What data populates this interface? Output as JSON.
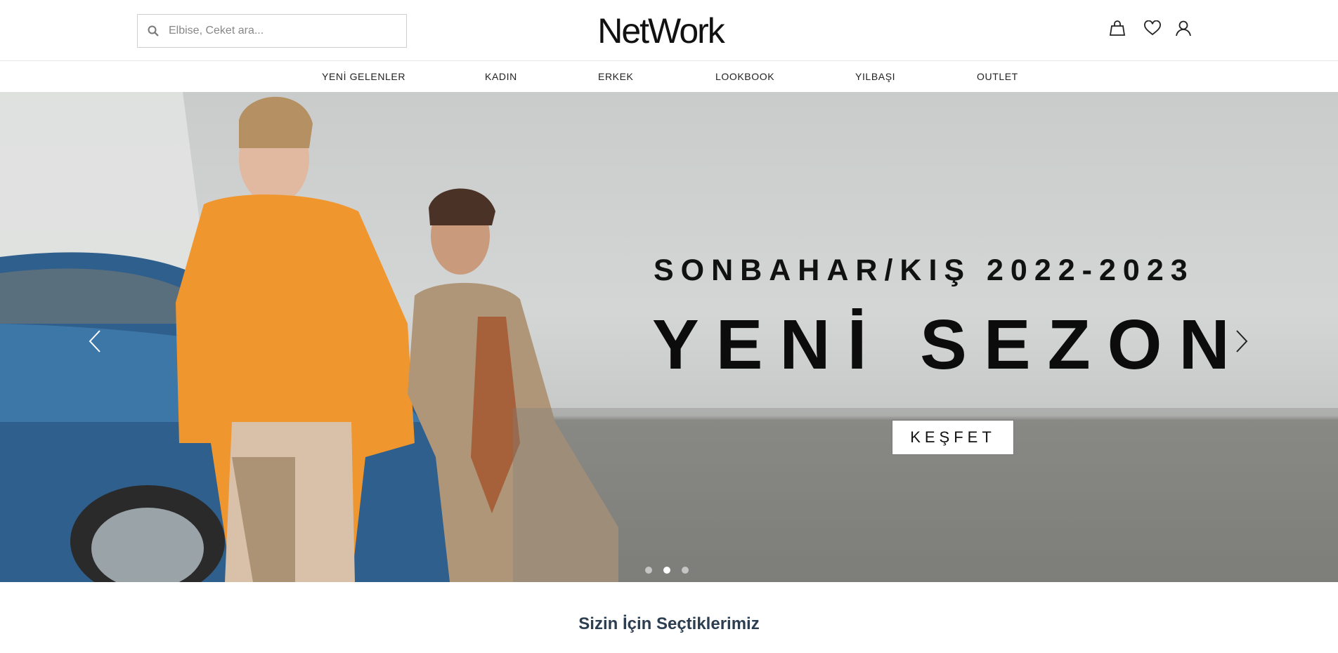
{
  "header": {
    "search": {
      "placeholder": "Elbise, Ceket ara...",
      "value": ""
    },
    "logo": "NetWork",
    "icons": [
      "bag-icon",
      "heart-icon",
      "user-icon"
    ]
  },
  "nav": {
    "items": [
      {
        "label": "YENİ GELENLER"
      },
      {
        "label": "KADIN"
      },
      {
        "label": "ERKEK"
      },
      {
        "label": "LOOKBOOK"
      },
      {
        "label": "YILBAŞI"
      },
      {
        "label": "OUTLET"
      }
    ]
  },
  "hero": {
    "subtitle": "SONBAHAR/KIŞ 2022-2023",
    "title": "YENİ SEZON",
    "cta": "KEŞFET",
    "slides_total": 3,
    "active_slide": 2
  },
  "section": {
    "title": "Sizin İçin Seçtiklerimiz"
  },
  "colors": {
    "text": "#222222",
    "section_title": "#2c3e50",
    "background": "#ffffff"
  }
}
